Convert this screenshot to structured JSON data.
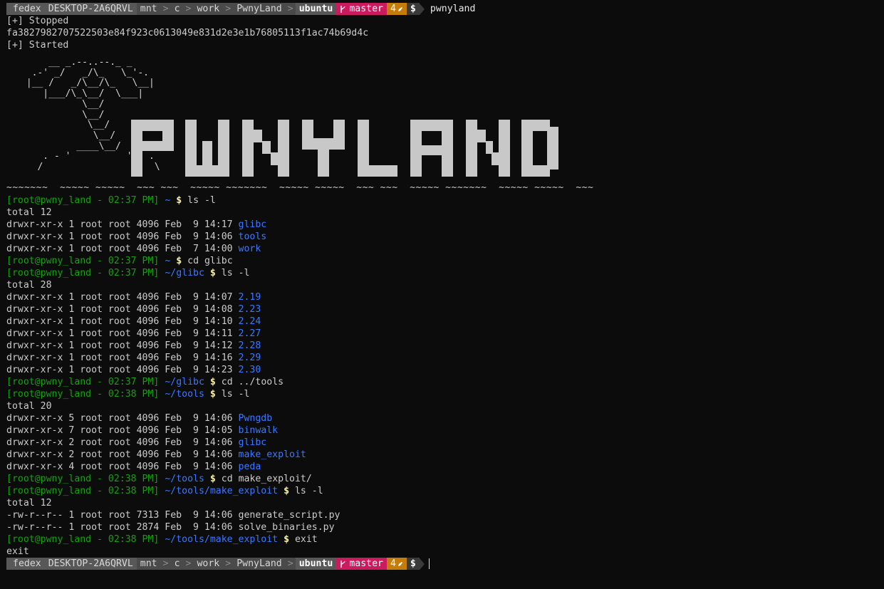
{
  "prompt_bar": {
    "user": "fedex",
    "host": "DESKTOP-2A6QRVL",
    "path": [
      "mnt",
      "c",
      "work",
      "PwnyLand"
    ],
    "cwd": "ubuntu",
    "branch": "master",
    "branch_icon": "git-branch-icon",
    "changes": "4",
    "changes_icon": "pencil-icon",
    "symbol": "$",
    "separator": ">"
  },
  "first_command": "pwnyland",
  "startup_output": [
    "[+] Stopped",
    "fa3827982707522503e84f923c0613049e831d2e3e1b76805113f1ac74b69d4c",
    "[+] Started"
  ],
  "banner": {
    "logo_text": "PWNYLAND",
    "ascii_art": "     __ _.--..--._ _\n  .-' _/   _/\\_   \\_'-.\n |__ /   _/\\__/\\_   \\__|\n    |___/\\_\\__/  \\___|\n           \\__/\n           \\__/\n            \\__/\n             \\__/\n          ____\\__/\n    . - '          ' - .\n   /                    \\",
    "wave_line": "~~~~~~~  ~~~~~ ~~~~~  ~~~ ~~~  ~~~~~ ~~~~~~~  ~~~~~ ~~~~~  ~~~ ~~~  ~~~~~ ~~~~~~~  ~~~~~ ~~~~~  ~~~"
  },
  "session": [
    {
      "kind": "prompt",
      "user": "[root@pwny_land - 02:37 PM]",
      "dir": "~",
      "sym": "$",
      "cmd": "ls -l"
    },
    {
      "kind": "out",
      "text": "total 12"
    },
    {
      "kind": "entry",
      "meta": "drwxr-xr-x 1 root root 4096 Feb  9 14:17",
      "name": "glibc",
      "dir": true
    },
    {
      "kind": "entry",
      "meta": "drwxr-xr-x 1 root root 4096 Feb  9 14:06",
      "name": "tools",
      "dir": true
    },
    {
      "kind": "entry",
      "meta": "drwxr-xr-x 1 root root 4096 Feb  7 14:00",
      "name": "work",
      "dir": true
    },
    {
      "kind": "prompt",
      "user": "[root@pwny_land - 02:37 PM]",
      "dir": "~",
      "sym": "$",
      "cmd": "cd glibc"
    },
    {
      "kind": "prompt",
      "user": "[root@pwny_land - 02:37 PM]",
      "dir": "~/glibc",
      "sym": "$",
      "cmd": "ls -l"
    },
    {
      "kind": "out",
      "text": "total 28"
    },
    {
      "kind": "entry",
      "meta": "drwxr-xr-x 1 root root 4096 Feb  9 14:07",
      "name": "2.19",
      "dir": true
    },
    {
      "kind": "entry",
      "meta": "drwxr-xr-x 1 root root 4096 Feb  9 14:08",
      "name": "2.23",
      "dir": true
    },
    {
      "kind": "entry",
      "meta": "drwxr-xr-x 1 root root 4096 Feb  9 14:10",
      "name": "2.24",
      "dir": true
    },
    {
      "kind": "entry",
      "meta": "drwxr-xr-x 1 root root 4096 Feb  9 14:11",
      "name": "2.27",
      "dir": true
    },
    {
      "kind": "entry",
      "meta": "drwxr-xr-x 1 root root 4096 Feb  9 14:12",
      "name": "2.28",
      "dir": true
    },
    {
      "kind": "entry",
      "meta": "drwxr-xr-x 1 root root 4096 Feb  9 14:16",
      "name": "2.29",
      "dir": true
    },
    {
      "kind": "entry",
      "meta": "drwxr-xr-x 1 root root 4096 Feb  9 14:23",
      "name": "2.30",
      "dir": true
    },
    {
      "kind": "prompt",
      "user": "[root@pwny_land - 02:37 PM]",
      "dir": "~/glibc",
      "sym": "$",
      "cmd": "cd ../tools"
    },
    {
      "kind": "prompt",
      "user": "[root@pwny_land - 02:38 PM]",
      "dir": "~/tools",
      "sym": "$",
      "cmd": "ls -l"
    },
    {
      "kind": "out",
      "text": "total 20"
    },
    {
      "kind": "entry",
      "meta": "drwxr-xr-x 5 root root 4096 Feb  9 14:06",
      "name": "Pwngdb",
      "dir": true
    },
    {
      "kind": "entry",
      "meta": "drwxr-xr-x 7 root root 4096 Feb  9 14:05",
      "name": "binwalk",
      "dir": true
    },
    {
      "kind": "entry",
      "meta": "drwxr-xr-x 2 root root 4096 Feb  9 14:06",
      "name": "glibc",
      "dir": true
    },
    {
      "kind": "entry",
      "meta": "drwxr-xr-x 2 root root 4096 Feb  9 14:06",
      "name": "make_exploit",
      "dir": true
    },
    {
      "kind": "entry",
      "meta": "drwxr-xr-x 4 root root 4096 Feb  9 14:06",
      "name": "peda",
      "dir": true
    },
    {
      "kind": "prompt",
      "user": "[root@pwny_land - 02:38 PM]",
      "dir": "~/tools",
      "sym": "$",
      "cmd": "cd make_exploit/"
    },
    {
      "kind": "prompt",
      "user": "[root@pwny_land - 02:38 PM]",
      "dir": "~/tools/make_exploit",
      "sym": "$",
      "cmd": "ls -l"
    },
    {
      "kind": "out",
      "text": "total 12"
    },
    {
      "kind": "entry",
      "meta": "-rw-r--r-- 1 root root 7313 Feb  9 14:06",
      "name": "generate_script.py",
      "dir": false
    },
    {
      "kind": "entry",
      "meta": "-rw-r--r-- 1 root root 2874 Feb  9 14:06",
      "name": "solve_binaries.py",
      "dir": false
    },
    {
      "kind": "prompt",
      "user": "[root@pwny_land - 02:38 PM]",
      "dir": "~/tools/make_exploit",
      "sym": "$",
      "cmd": "exit"
    },
    {
      "kind": "out",
      "text": "exit"
    }
  ],
  "colors": {
    "background": "#0c0c0c",
    "prompt_user": "#13a10e",
    "directory": "#3b78ff",
    "dollar": "#f9f1a5",
    "branch_segment": "#cc1a5e",
    "changes_segment": "#c47d0b"
  }
}
